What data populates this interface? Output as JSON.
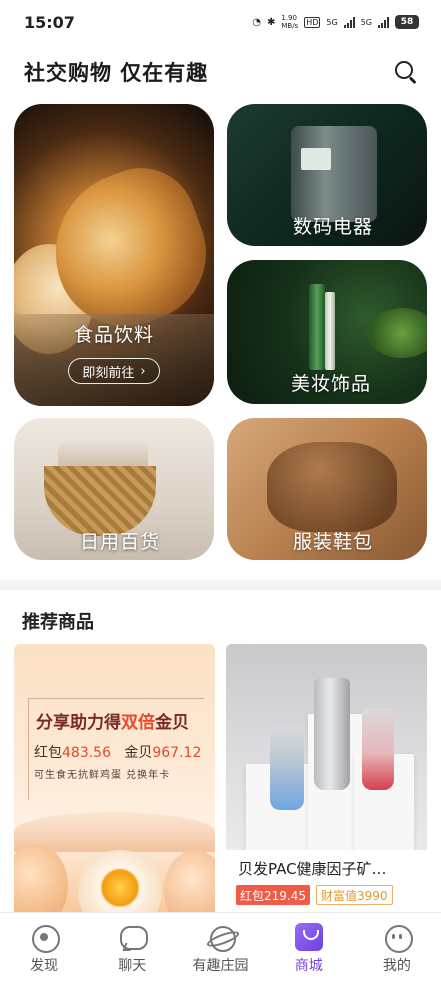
{
  "status_bar": {
    "time": "15:07",
    "net_speed": "1.90\nMB/s",
    "hd": "HD",
    "sig1": "5G",
    "sig2": "5G",
    "battery": "58"
  },
  "header": {
    "title": "社交购物 仅在有趣",
    "search_icon": "search-icon"
  },
  "categories": [
    {
      "label": "食品饮料",
      "cta": "即刻前往"
    },
    {
      "label": "数码电器"
    },
    {
      "label": "美妆饰品"
    },
    {
      "label": "日用百货"
    },
    {
      "label": "服装鞋包"
    }
  ],
  "recommend": {
    "title": "推荐商品",
    "promo": {
      "headline_a": "分享助力得",
      "headline_b": "双倍",
      "headline_c": "金贝",
      "redpack_label": "红包",
      "redpack_value": "483.56",
      "gold_label": "金贝",
      "gold_value": "967.12",
      "subtitle": "可生食无抗鲜鸡蛋 兑换年卡"
    },
    "product": {
      "name": "贝发PAC健康因子矿…",
      "redpack_tag": "红包219.45",
      "wealth_tag": "财富值3990"
    }
  },
  "tabbar": {
    "tabs": [
      {
        "label": "发现",
        "icon": "discover-icon"
      },
      {
        "label": "聊天",
        "icon": "chat-icon"
      },
      {
        "label": "有趣庄园",
        "icon": "farm-icon"
      },
      {
        "label": "商城",
        "icon": "mall-icon"
      },
      {
        "label": "我的",
        "icon": "profile-icon"
      }
    ],
    "active_index": 3,
    "active_color": "#7a43e6"
  }
}
